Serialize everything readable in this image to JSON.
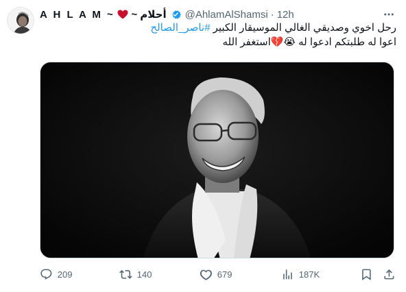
{
  "tweet": {
    "display_name": "A H L A M ~",
    "display_name_ar": "~ أحلام",
    "handle": "@AhlamAlShamsi",
    "separator": "·",
    "time": "12h",
    "text_line1_a": "رحل اخوي وصديقي  الغالي الموسيقار الكبير ",
    "hashtag": "#ناصر_الصالح",
    "text_line2": "اعوا له طلبتكم ادعوا له 😭💔استغفر الله",
    "media_alt": "Black and white portrait of a smiling man with glasses",
    "actions": {
      "replies": "209",
      "retweets": "140",
      "likes": "679",
      "views": "187K"
    },
    "accent_color": "#1d9bf0",
    "heart_color": "#c8102e"
  }
}
